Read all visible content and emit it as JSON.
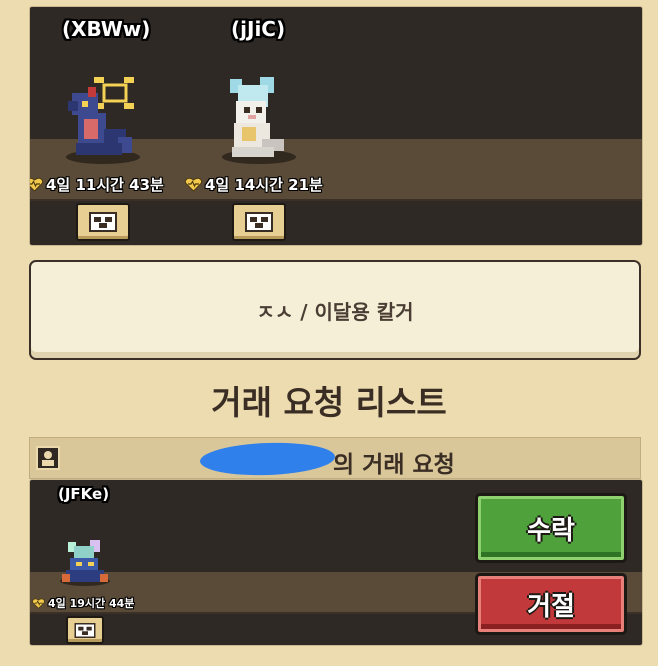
{
  "pets_panel": {
    "pets": [
      {
        "name": "(XBWw)",
        "time": "4일 11시간 43분",
        "sprite": "blue-dragon-sprite"
      },
      {
        "name": "(jJiC)",
        "time": "4일 14시간 21분",
        "sprite": "white-dragon-sprite"
      }
    ]
  },
  "input": {
    "text": "ㅈㅅ / 이달용 칼거"
  },
  "section_title": "거래 요청 리스트",
  "request": {
    "header_text": "의 거래 요청",
    "pet": {
      "name": "(JFKe)",
      "time": "4일 19시간 44분",
      "sprite": "crystal-dragon-sprite"
    },
    "accept_label": "수락",
    "reject_label": "거절"
  },
  "colors": {
    "background": "#ecdcb0",
    "panel": "#2e2925",
    "accept": "#4fa13c",
    "reject": "#c1393a",
    "heart": "#f2c94c"
  },
  "icons": [
    "heart-icon",
    "info-icon",
    "user-icon"
  ]
}
